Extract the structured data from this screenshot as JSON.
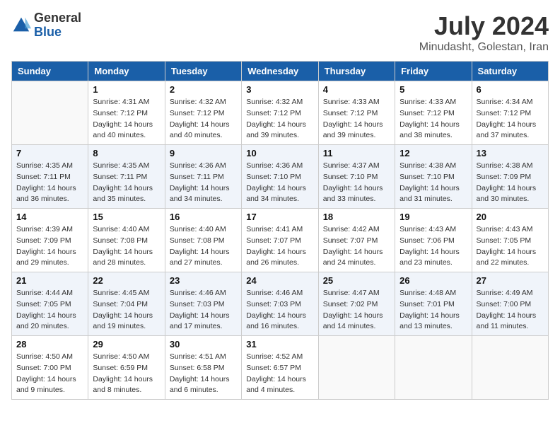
{
  "logo": {
    "general": "General",
    "blue": "Blue"
  },
  "title": "July 2024",
  "location": "Minudasht, Golestan, Iran",
  "days_of_week": [
    "Sunday",
    "Monday",
    "Tuesday",
    "Wednesday",
    "Thursday",
    "Friday",
    "Saturday"
  ],
  "weeks": [
    [
      {
        "day": "",
        "info": ""
      },
      {
        "day": "1",
        "info": "Sunrise: 4:31 AM\nSunset: 7:12 PM\nDaylight: 14 hours\nand 40 minutes."
      },
      {
        "day": "2",
        "info": "Sunrise: 4:32 AM\nSunset: 7:12 PM\nDaylight: 14 hours\nand 40 minutes."
      },
      {
        "day": "3",
        "info": "Sunrise: 4:32 AM\nSunset: 7:12 PM\nDaylight: 14 hours\nand 39 minutes."
      },
      {
        "day": "4",
        "info": "Sunrise: 4:33 AM\nSunset: 7:12 PM\nDaylight: 14 hours\nand 39 minutes."
      },
      {
        "day": "5",
        "info": "Sunrise: 4:33 AM\nSunset: 7:12 PM\nDaylight: 14 hours\nand 38 minutes."
      },
      {
        "day": "6",
        "info": "Sunrise: 4:34 AM\nSunset: 7:12 PM\nDaylight: 14 hours\nand 37 minutes."
      }
    ],
    [
      {
        "day": "7",
        "info": "Sunrise: 4:35 AM\nSunset: 7:11 PM\nDaylight: 14 hours\nand 36 minutes."
      },
      {
        "day": "8",
        "info": "Sunrise: 4:35 AM\nSunset: 7:11 PM\nDaylight: 14 hours\nand 35 minutes."
      },
      {
        "day": "9",
        "info": "Sunrise: 4:36 AM\nSunset: 7:11 PM\nDaylight: 14 hours\nand 34 minutes."
      },
      {
        "day": "10",
        "info": "Sunrise: 4:36 AM\nSunset: 7:10 PM\nDaylight: 14 hours\nand 34 minutes."
      },
      {
        "day": "11",
        "info": "Sunrise: 4:37 AM\nSunset: 7:10 PM\nDaylight: 14 hours\nand 33 minutes."
      },
      {
        "day": "12",
        "info": "Sunrise: 4:38 AM\nSunset: 7:10 PM\nDaylight: 14 hours\nand 31 minutes."
      },
      {
        "day": "13",
        "info": "Sunrise: 4:38 AM\nSunset: 7:09 PM\nDaylight: 14 hours\nand 30 minutes."
      }
    ],
    [
      {
        "day": "14",
        "info": "Sunrise: 4:39 AM\nSunset: 7:09 PM\nDaylight: 14 hours\nand 29 minutes."
      },
      {
        "day": "15",
        "info": "Sunrise: 4:40 AM\nSunset: 7:08 PM\nDaylight: 14 hours\nand 28 minutes."
      },
      {
        "day": "16",
        "info": "Sunrise: 4:40 AM\nSunset: 7:08 PM\nDaylight: 14 hours\nand 27 minutes."
      },
      {
        "day": "17",
        "info": "Sunrise: 4:41 AM\nSunset: 7:07 PM\nDaylight: 14 hours\nand 26 minutes."
      },
      {
        "day": "18",
        "info": "Sunrise: 4:42 AM\nSunset: 7:07 PM\nDaylight: 14 hours\nand 24 minutes."
      },
      {
        "day": "19",
        "info": "Sunrise: 4:43 AM\nSunset: 7:06 PM\nDaylight: 14 hours\nand 23 minutes."
      },
      {
        "day": "20",
        "info": "Sunrise: 4:43 AM\nSunset: 7:05 PM\nDaylight: 14 hours\nand 22 minutes."
      }
    ],
    [
      {
        "day": "21",
        "info": "Sunrise: 4:44 AM\nSunset: 7:05 PM\nDaylight: 14 hours\nand 20 minutes."
      },
      {
        "day": "22",
        "info": "Sunrise: 4:45 AM\nSunset: 7:04 PM\nDaylight: 14 hours\nand 19 minutes."
      },
      {
        "day": "23",
        "info": "Sunrise: 4:46 AM\nSunset: 7:03 PM\nDaylight: 14 hours\nand 17 minutes."
      },
      {
        "day": "24",
        "info": "Sunrise: 4:46 AM\nSunset: 7:03 PM\nDaylight: 14 hours\nand 16 minutes."
      },
      {
        "day": "25",
        "info": "Sunrise: 4:47 AM\nSunset: 7:02 PM\nDaylight: 14 hours\nand 14 minutes."
      },
      {
        "day": "26",
        "info": "Sunrise: 4:48 AM\nSunset: 7:01 PM\nDaylight: 14 hours\nand 13 minutes."
      },
      {
        "day": "27",
        "info": "Sunrise: 4:49 AM\nSunset: 7:00 PM\nDaylight: 14 hours\nand 11 minutes."
      }
    ],
    [
      {
        "day": "28",
        "info": "Sunrise: 4:50 AM\nSunset: 7:00 PM\nDaylight: 14 hours\nand 9 minutes."
      },
      {
        "day": "29",
        "info": "Sunrise: 4:50 AM\nSunset: 6:59 PM\nDaylight: 14 hours\nand 8 minutes."
      },
      {
        "day": "30",
        "info": "Sunrise: 4:51 AM\nSunset: 6:58 PM\nDaylight: 14 hours\nand 6 minutes."
      },
      {
        "day": "31",
        "info": "Sunrise: 4:52 AM\nSunset: 6:57 PM\nDaylight: 14 hours\nand 4 minutes."
      },
      {
        "day": "",
        "info": ""
      },
      {
        "day": "",
        "info": ""
      },
      {
        "day": "",
        "info": ""
      }
    ]
  ]
}
